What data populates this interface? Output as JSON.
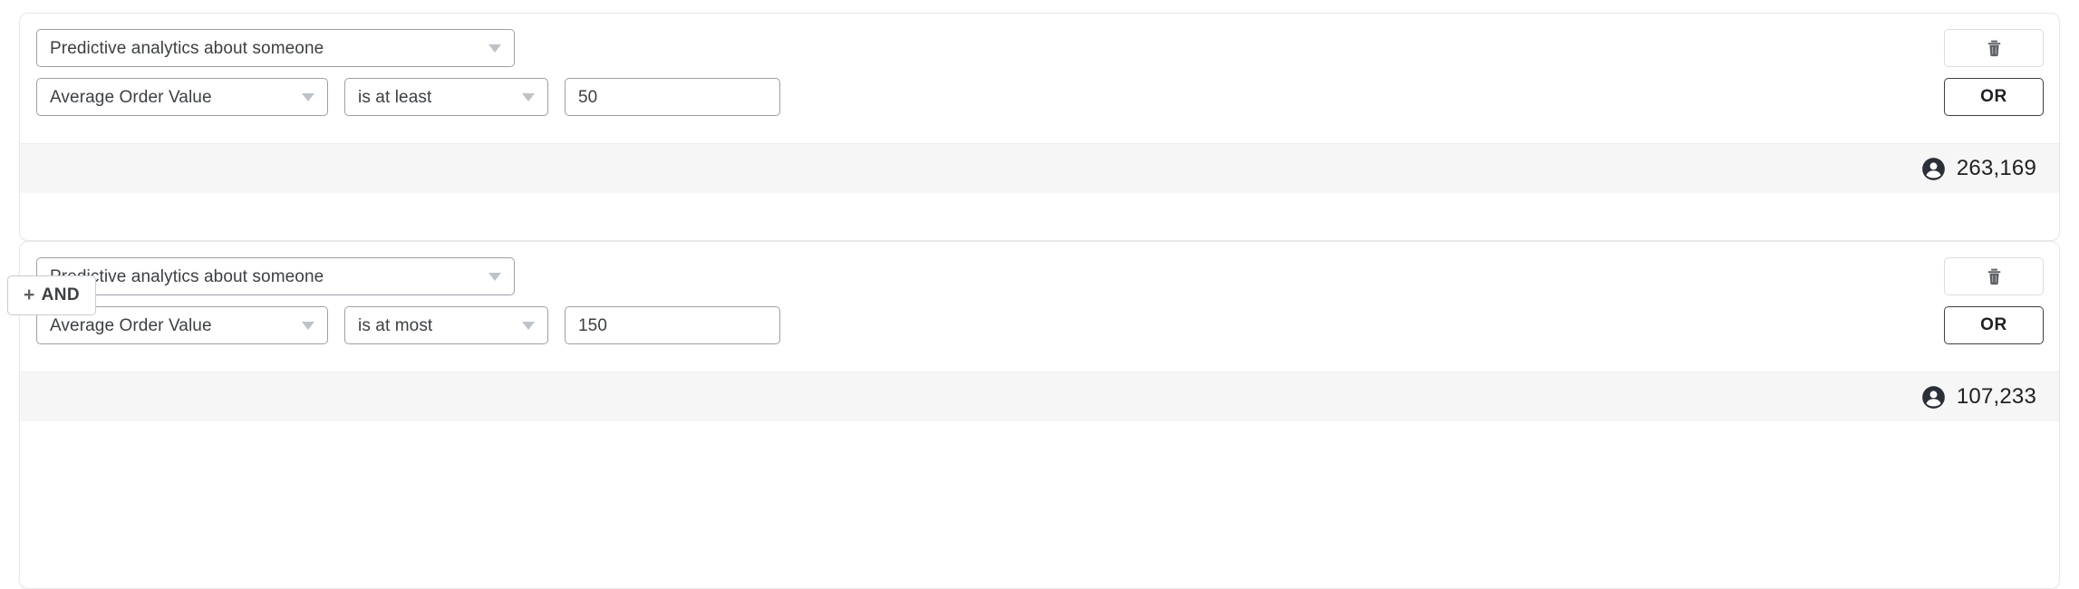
{
  "segment_builder": {
    "groups": [
      {
        "id": "group-1",
        "attribute_select": {
          "value": "Predictive analytics about someone",
          "icon": "chevron-down-icon"
        },
        "metric_select": {
          "value": "Average Order Value",
          "icon": "chevron-down-icon"
        },
        "operator_select": {
          "value": "is at least",
          "icon": "chevron-down-icon"
        },
        "value_input": {
          "value": "50",
          "placeholder": ""
        },
        "delete_button": {
          "label": "",
          "icon": "trash-icon"
        },
        "or_button": {
          "label": "OR"
        },
        "footer": {
          "icon": "person-icon",
          "count": "263,169"
        }
      },
      {
        "id": "group-2",
        "attribute_select": {
          "value": "Predictive analytics about someone",
          "icon": "chevron-down-icon"
        },
        "metric_select": {
          "value": "Average Order Value",
          "icon": "chevron-down-icon"
        },
        "operator_select": {
          "value": "is at most",
          "icon": "chevron-down-icon"
        },
        "value_input": {
          "value": "150",
          "placeholder": ""
        },
        "delete_button": {
          "label": "",
          "icon": "trash-icon"
        },
        "or_button": {
          "label": "OR"
        },
        "footer": {
          "icon": "person-icon",
          "count": "107,233"
        }
      }
    ],
    "and_connector": {
      "plus_glyph": "+",
      "label": "AND"
    },
    "colors": {
      "card_border": "#e7e8ea",
      "field_border": "#9aa0a6",
      "footer_background": "#f6f6f7",
      "text_primary": "#202124",
      "text_secondary": "#3c4043",
      "caret": "#bdc3c9",
      "connector_line": "#d9dbdd"
    }
  }
}
